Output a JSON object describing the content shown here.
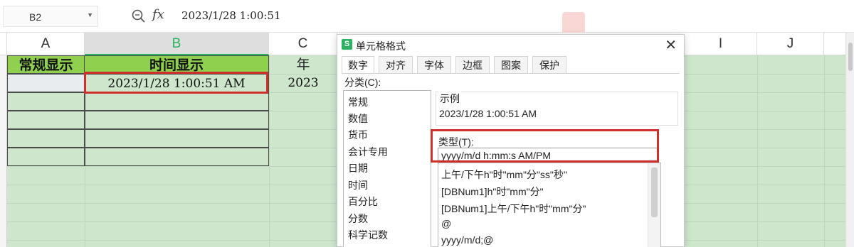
{
  "formula_bar": {
    "name_box": "B2",
    "fx_label": "fx",
    "formula_value": "2023/1/28  1:00:51"
  },
  "columns": [
    "A",
    "B",
    "C",
    "I",
    "J"
  ],
  "sheet": {
    "headers": {
      "A": "常规显示",
      "B": "时间显示",
      "C": "年"
    },
    "row2": {
      "B": "2023/1/28  1:00:51  AM",
      "C": "2023"
    }
  },
  "dialog": {
    "title": "单元格格式",
    "close": "✕",
    "tabs": [
      "数字",
      "对齐",
      "字体",
      "边框",
      "图案",
      "保护"
    ],
    "selected_tab": "数字",
    "category_label": "分类(C):",
    "categories": [
      "常规",
      "数值",
      "货币",
      "会计专用",
      "日期",
      "时间",
      "百分比",
      "分数",
      "科学记数"
    ],
    "sample_label": "示例",
    "sample_value": "2023/1/28 1:00:51 AM",
    "type_label": "类型(T):",
    "type_value": "yyyy/m/d h:mm:s AM/PM",
    "type_list": [
      "上午/下午h\"时\"mm\"分\"ss\"秒\"",
      "[DBNum1]h\"时\"mm\"分\"",
      "[DBNum1]上午/下午h\"时\"mm\"分\"",
      "@",
      "yyyy/m/d;@"
    ]
  },
  "colors": {
    "sheet_background": "#cde6cc",
    "header_fill": "#8fd04e",
    "highlight_red": "#d0302b",
    "accent_green": "#2bb160"
  }
}
